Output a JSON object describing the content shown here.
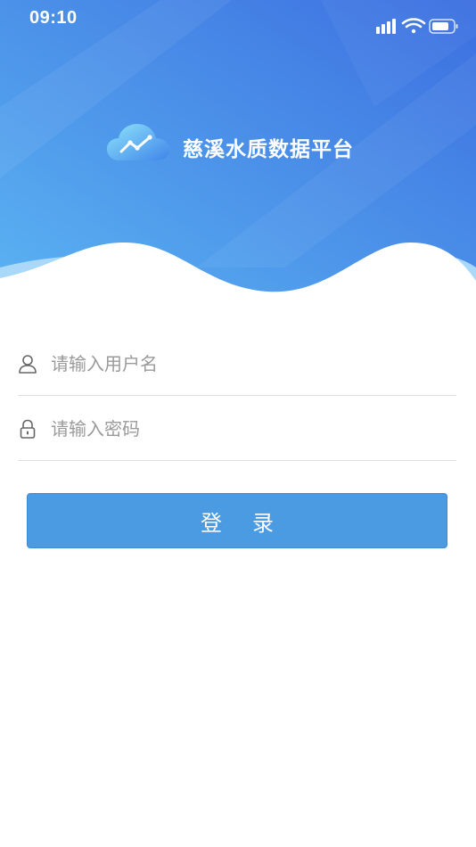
{
  "status_bar": {
    "time": "09:10",
    "icons": [
      "signal-icon",
      "wifi-icon",
      "battery-icon"
    ]
  },
  "brand": {
    "logo_icon": "cloud-chart-icon",
    "title": "慈溪水质数据平台"
  },
  "form": {
    "username": {
      "icon": "user-icon",
      "placeholder": "请输入用户名",
      "value": ""
    },
    "password": {
      "icon": "lock-icon",
      "placeholder": "请输入密码",
      "value": ""
    },
    "login_label": "登录"
  },
  "colors": {
    "header_gradient_start": "#5bb0f0",
    "header_gradient_end": "#3f73e0",
    "button": "#4a9be2",
    "wave_light": "#a9d8f8"
  }
}
